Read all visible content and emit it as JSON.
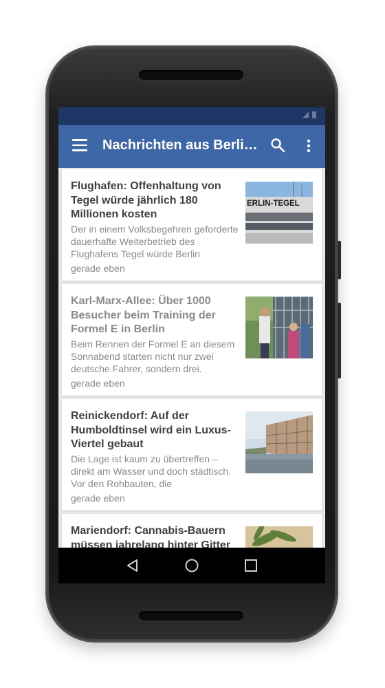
{
  "status_bar": {
    "carrier": "",
    "time": ""
  },
  "app_bar": {
    "title": "Nachrichten aus Berli…",
    "menu_icon": "hamburger-menu-icon",
    "search_icon": "search-icon",
    "more_icon": "more-vert-icon",
    "color": "#3f68a8"
  },
  "articles": [
    {
      "title": "Flughafen: Offenhaltung von Tegel würde jährlich 180 Millionen kosten",
      "teaser": "Der in einem Volksbegehren geforderte dauerhafte Weiterbetrieb des Flughafens Tegel würde Berlin",
      "time": "gerade eben",
      "image": "tegel-airport-terminal-photo",
      "image_text": "ERLIN-TEGEL",
      "read": false
    },
    {
      "title": "Karl-Marx-Allee: Über 1000 Besucher beim Training der Formel E in Berlin",
      "teaser": "Beim Rennen der Formel E an diesem Sonnabend starten nicht nur zwei deutsche Fahrer, sondern drei.",
      "time": "gerade eben",
      "image": "formula-e-fans-photo",
      "read": true
    },
    {
      "title": "Reinickendorf: Auf der Humboldtinsel wird ein Luxus-Viertel gebaut",
      "teaser": "Die Lage ist kaum zu übertreffen – direkt am Wasser und doch städtisch. Vor den Rohbauten, die",
      "time": "gerade eben",
      "image": "humboldtinsel-construction-photo",
      "read": false
    },
    {
      "title": "Mariendorf: Cannabis-Bauern müssen jahrelang hinter Gitter",
      "teaser": "",
      "time": "",
      "image": "cannabis-plants-photo",
      "read": false
    }
  ],
  "nav_bar": {
    "back_icon": "back-triangle-icon",
    "home_icon": "home-circle-icon",
    "recents_icon": "recents-square-icon"
  },
  "text_color_unread": "#404040",
  "text_color_read": "#8a8a8a"
}
